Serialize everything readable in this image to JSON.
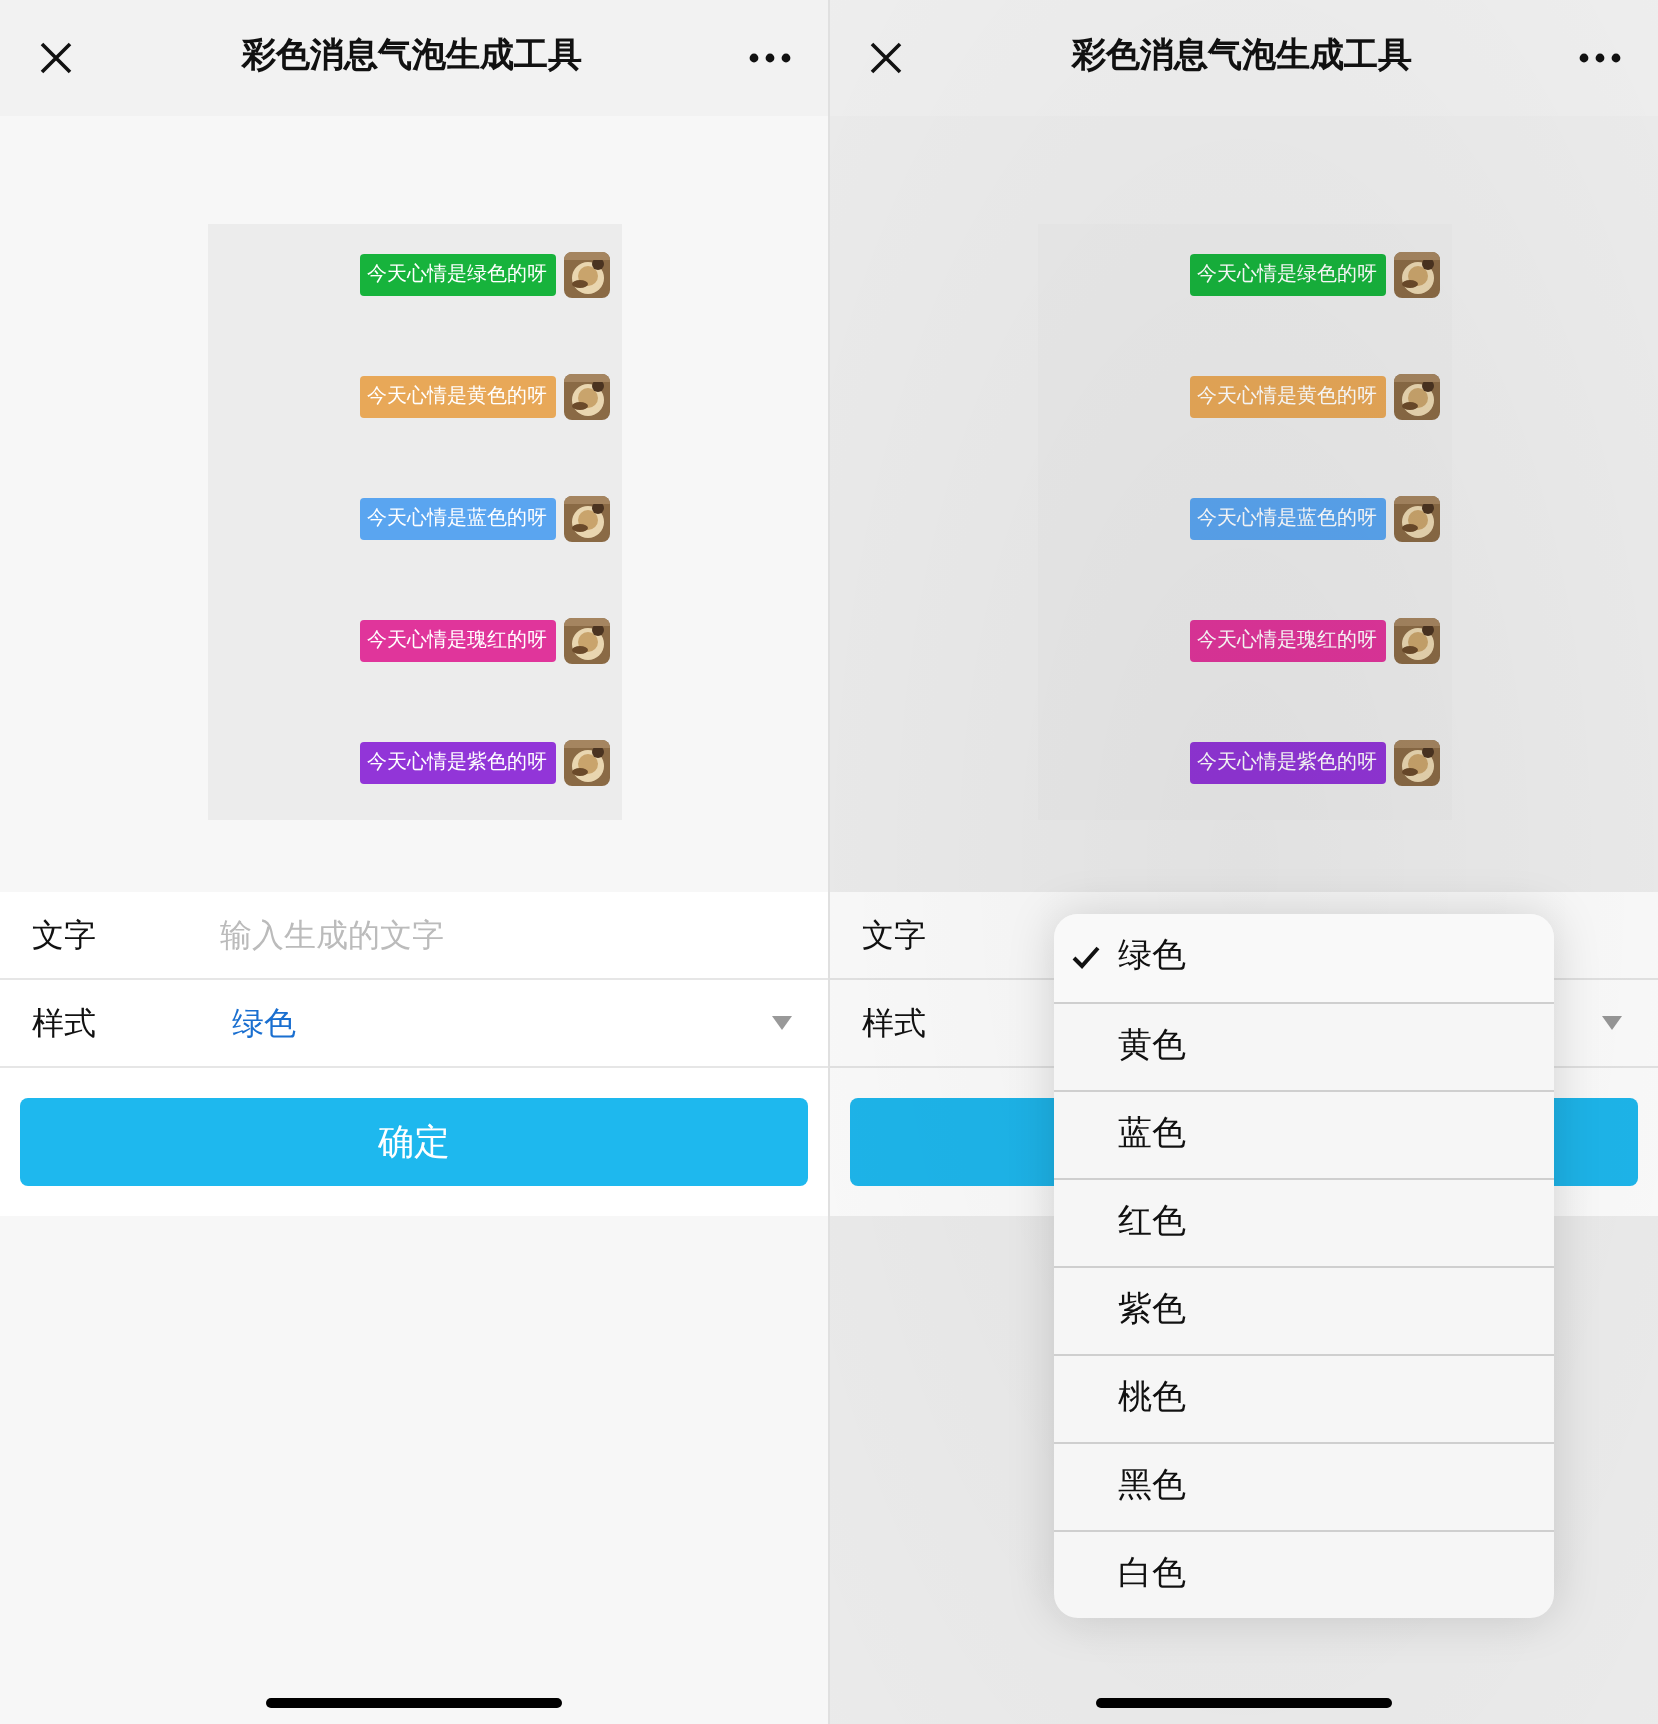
{
  "screens": [
    {
      "title": "彩色消息气泡生成工具",
      "dimmed": false,
      "bubbles": [
        {
          "text": "今天心情是绿色的呀",
          "color": "#17b33c"
        },
        {
          "text": "今天心情是黄色的呀",
          "color": "#e8a858"
        },
        {
          "text": "今天心情是蓝色的呀",
          "color": "#5aa5f0"
        },
        {
          "text": "今天心情是瑰红的呀",
          "color": "#e0359b"
        },
        {
          "text": "今天心情是紫色的呀",
          "color": "#9235d8"
        }
      ],
      "text_label": "文字",
      "text_placeholder": "输入生成的文字",
      "style_label": "样式",
      "style_value": "绿色",
      "confirm": "确定"
    },
    {
      "title": "彩色消息气泡生成工具",
      "dimmed": true,
      "bubbles": [
        {
          "text": "今天心情是绿色的呀",
          "color": "#17b33c"
        },
        {
          "text": "今天心情是黄色的呀",
          "color": "#e8a858"
        },
        {
          "text": "今天心情是蓝色的呀",
          "color": "#5aa5f0"
        },
        {
          "text": "今天心情是瑰红的呀",
          "color": "#e0359b"
        },
        {
          "text": "今天心情是紫色的呀",
          "color": "#9235d8"
        }
      ],
      "text_label": "文字",
      "style_label": "样式",
      "dropdown": [
        {
          "label": "绿色",
          "selected": true
        },
        {
          "label": "黄色",
          "selected": false
        },
        {
          "label": "蓝色",
          "selected": false
        },
        {
          "label": "红色",
          "selected": false
        },
        {
          "label": "紫色",
          "selected": false
        },
        {
          "label": "桃色",
          "selected": false
        },
        {
          "label": "黑色",
          "selected": false
        },
        {
          "label": "白色",
          "selected": false
        }
      ]
    }
  ]
}
